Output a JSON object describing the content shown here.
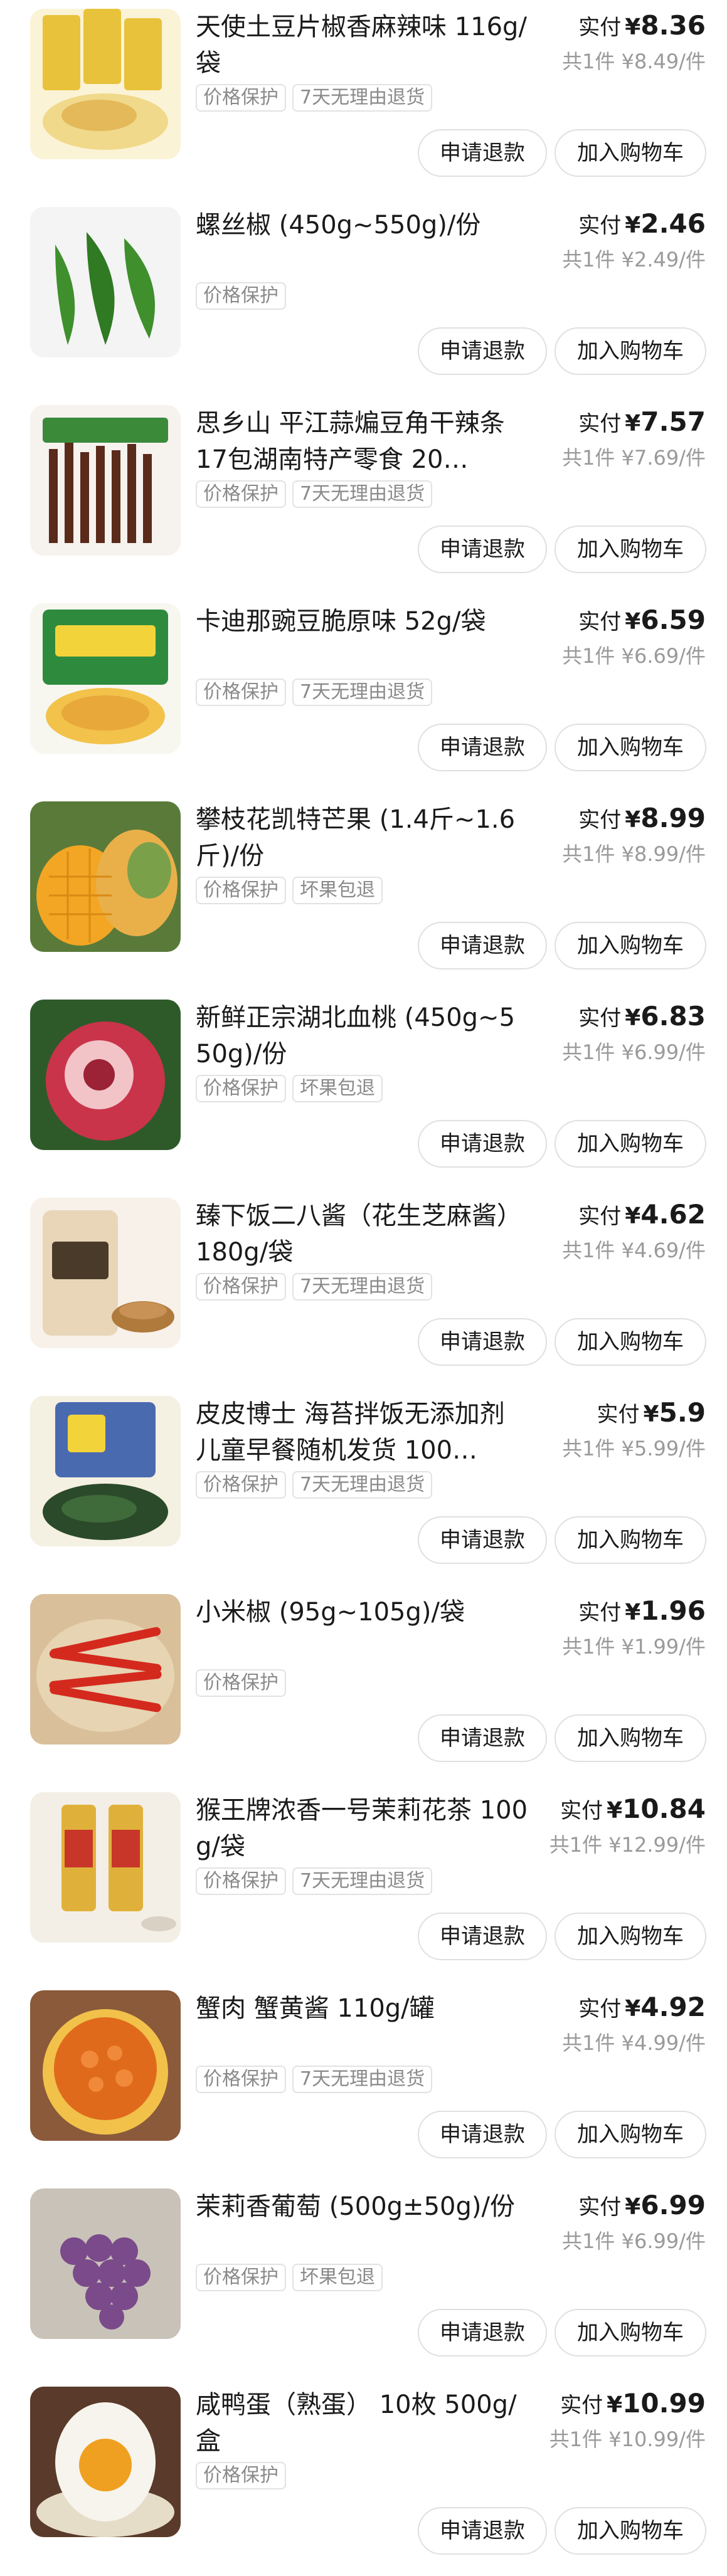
{
  "orders": [
    {
      "title": "天使土豆片椒香麻辣味 116g/袋",
      "tags": [
        "价格保护",
        "7天无理由退货"
      ],
      "actual_label": "实付",
      "currency": "¥",
      "actual_price": "8.36",
      "sub_text": "共1件 ¥8.49/件",
      "refund_label": "申请退款",
      "cart_label": "加入购物车",
      "image": "potato-chips-icon",
      "color": "#e8c23a"
    },
    {
      "title": "螺丝椒 (450g~550g)/份",
      "tags": [
        "价格保护"
      ],
      "actual_label": "实付",
      "currency": "¥",
      "actual_price": "2.46",
      "sub_text": "共1件 ¥2.49/件",
      "refund_label": "申请退款",
      "cart_label": "加入购物车",
      "image": "green-pepper-icon",
      "color": "#3f8f2d"
    },
    {
      "title": "思乡山 平江蒜煸豆角干辣条 17包湖南特产零食 20…",
      "tags": [
        "价格保护",
        "7天无理由退货"
      ],
      "actual_label": "实付",
      "currency": "¥",
      "actual_price": "7.57",
      "sub_text": "共1件 ¥7.69/件",
      "refund_label": "申请退款",
      "cart_label": "加入购物车",
      "image": "spicy-strips-icon",
      "color": "#5a2a1a"
    },
    {
      "title": "卡迪那豌豆脆原味 52g/袋",
      "tags": [
        "价格保护",
        "7天无理由退货"
      ],
      "actual_label": "实付",
      "currency": "¥",
      "actual_price": "6.59",
      "sub_text": "共1件 ¥6.69/件",
      "refund_label": "申请退款",
      "cart_label": "加入购物车",
      "image": "pea-snack-icon",
      "color": "#2e8b3e"
    },
    {
      "title": "攀枝花凯特芒果 (1.4斤~1.6斤)/份",
      "tags": [
        "价格保护",
        "坏果包退"
      ],
      "actual_label": "实付",
      "currency": "¥",
      "actual_price": "8.99",
      "sub_text": "共1件 ¥8.99/件",
      "refund_label": "申请退款",
      "cart_label": "加入购物车",
      "image": "mango-icon",
      "color": "#f2a623"
    },
    {
      "title": "新鲜正宗湖北血桃 (450g~550g)/份",
      "tags": [
        "价格保护",
        "坏果包退"
      ],
      "actual_label": "实付",
      "currency": "¥",
      "actual_price": "6.83",
      "sub_text": "共1件 ¥6.99/件",
      "refund_label": "申请退款",
      "cart_label": "加入购物车",
      "image": "blood-peach-icon",
      "color": "#c9344a"
    },
    {
      "title": "臻下饭二八酱（花生芝麻酱） 180g/袋",
      "tags": [
        "价格保护",
        "7天无理由退货"
      ],
      "actual_label": "实付",
      "currency": "¥",
      "actual_price": "4.62",
      "sub_text": "共1件 ¥4.69/件",
      "refund_label": "申请退款",
      "cart_label": "加入购物车",
      "image": "sesame-paste-icon",
      "color": "#b07a3c"
    },
    {
      "title": "皮皮博士 海苔拌饭无添加剂儿童早餐随机发货 100…",
      "tags": [
        "价格保护",
        "7天无理由退货"
      ],
      "actual_label": "实付",
      "currency": "¥",
      "actual_price": "5.9",
      "sub_text": "共1件 ¥5.99/件",
      "refund_label": "申请退款",
      "cart_label": "加入购物车",
      "image": "seaweed-icon",
      "color": "#2b4a2a"
    },
    {
      "title": "小米椒 (95g~105g)/袋",
      "tags": [
        "价格保护"
      ],
      "actual_label": "实付",
      "currency": "¥",
      "actual_price": "1.96",
      "sub_text": "共1件 ¥1.99/件",
      "refund_label": "申请退款",
      "cart_label": "加入购物车",
      "image": "red-chili-icon",
      "color": "#d42a1e"
    },
    {
      "title": "猴王牌浓香一号茉莉花茶 100g/袋",
      "tags": [
        "价格保护",
        "7天无理由退货"
      ],
      "actual_label": "实付",
      "currency": "¥",
      "actual_price": "10.84",
      "sub_text": "共1件 ¥12.99/件",
      "refund_label": "申请退款",
      "cart_label": "加入购物车",
      "image": "jasmine-tea-icon",
      "color": "#e0b13a"
    },
    {
      "title": "蟹肉 蟹黄酱 110g/罐",
      "tags": [
        "价格保护",
        "7天无理由退货"
      ],
      "actual_label": "实付",
      "currency": "¥",
      "actual_price": "4.92",
      "sub_text": "共1件 ¥4.99/件",
      "refund_label": "申请退款",
      "cart_label": "加入购物车",
      "image": "crab-sauce-icon",
      "color": "#e06a1c"
    },
    {
      "title": "茉莉香葡萄 (500g±50g)/份",
      "tags": [
        "价格保护",
        "坏果包退"
      ],
      "actual_label": "实付",
      "currency": "¥",
      "actual_price": "6.99",
      "sub_text": "共1件 ¥6.99/件",
      "refund_label": "申请退款",
      "cart_label": "加入购物车",
      "image": "grapes-icon",
      "color": "#7a4a8a"
    },
    {
      "title": "咸鸭蛋（熟蛋） 10枚 500g/盒",
      "tags": [
        "价格保护"
      ],
      "actual_label": "实付",
      "currency": "¥",
      "actual_price": "10.99",
      "sub_text": "共1件 ¥10.99/件",
      "refund_label": "申请退款",
      "cart_label": "加入购物车",
      "image": "salted-egg-icon",
      "color": "#f0a020"
    }
  ]
}
